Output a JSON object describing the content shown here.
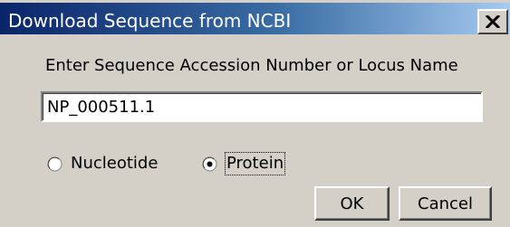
{
  "window": {
    "title": "Download Sequence from NCBI",
    "close_glyph": "close-icon"
  },
  "form": {
    "prompt": "Enter Sequence Accession Number or Locus Name",
    "accession_value": "NP_000511.1"
  },
  "sequence_type": {
    "selected": "Protein",
    "options": [
      {
        "label": "Nucleotide",
        "checked": false
      },
      {
        "label": "Protein",
        "checked": true
      }
    ]
  },
  "buttons": {
    "ok_label": "OK",
    "cancel_label": "Cancel"
  },
  "colors": {
    "title_start": "#0a246a",
    "title_end": "#a6caf0",
    "face": "#d4d0c8"
  }
}
